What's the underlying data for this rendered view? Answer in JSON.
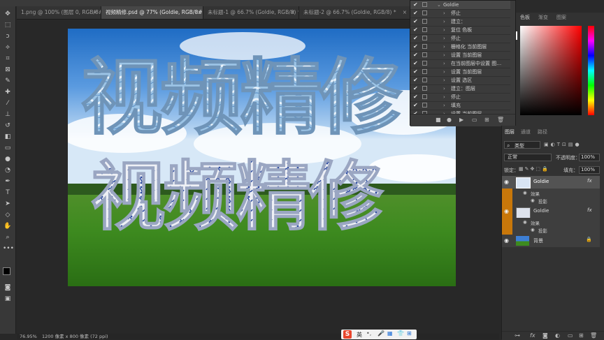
{
  "tabs": [
    {
      "label": "1.png @ 100% (图层 0, RGB/8#)",
      "close": "×"
    },
    {
      "label": "视频精修.psd @ 77% (Goldie, RGB/8#) *",
      "close": "×"
    },
    {
      "label": "未标题-1 @ 66.7% (Goldie, RGB/8) *",
      "close": "×"
    },
    {
      "label": "未标题-2 @ 66.7% (Goldie, RGB/8) *",
      "close": "×"
    }
  ],
  "canvas": {
    "title_top": "视频精修",
    "title_bottom": "视频精修"
  },
  "history": {
    "header": "Goldie",
    "items": [
      "停止",
      "建立：",
      "复位 色板",
      "停止",
      "栅格化 当前图层",
      "设置 当前图层",
      "在当前图层中设置 图…",
      "设置 当前图层",
      "设置 选区",
      "建立：图层",
      "停止",
      "填充",
      "设置 当前图层"
    ]
  },
  "color_panel": {
    "tabs": [
      "色板",
      "渐变",
      "图案"
    ]
  },
  "layers_panel": {
    "tabs": [
      "图层",
      "通道",
      "路径"
    ],
    "filter_label": "类型",
    "blend_mode": "正常",
    "opacity_label": "不透明度：",
    "opacity_value": "100%",
    "lock_label": "锁定：",
    "fill_label": "填充：",
    "fill_value": "100%",
    "layers": [
      {
        "name": "Goldie",
        "fx": "fx",
        "effects_label": "效果",
        "effect": "投影"
      },
      {
        "name": "Goldie",
        "fx": "fx",
        "effects_label": "效果",
        "effect": "投影"
      },
      {
        "name": "背景"
      }
    ]
  },
  "status": {
    "zoom": "76.95%",
    "doc_size": "1200 像素 x 800 像素 (72 ppi)"
  },
  "ime": {
    "lang": "英"
  },
  "colors": {
    "accent_orange": "#c8770a",
    "bg": "#282828",
    "panel": "#323232"
  }
}
